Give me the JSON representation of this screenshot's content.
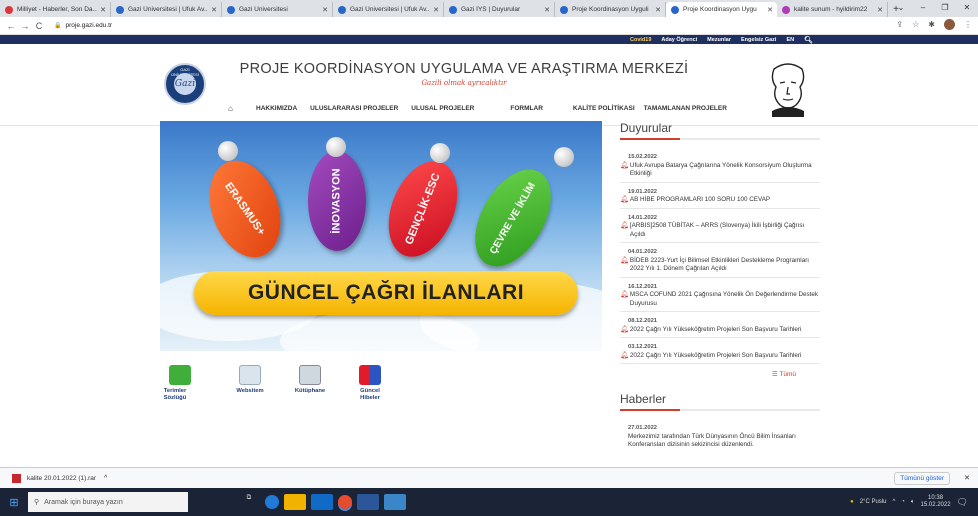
{
  "browser": {
    "tabs": [
      {
        "title": "Milliyet - Haberler, Son Da...",
        "color": "#d9373d"
      },
      {
        "title": "Gazi Üniversitesi | Ufuk Av...",
        "color": "#2a66c9"
      },
      {
        "title": "Gazi Üniversitesi",
        "color": "#2a66c9"
      },
      {
        "title": "Gazi Üniversitesi | Ufuk Av...",
        "color": "#2a66c9"
      },
      {
        "title": "Gazi İYS | Duyurular",
        "color": "#2a66c9"
      },
      {
        "title": "Proje Koordinasyon Uyguli",
        "color": "#2a66c9"
      },
      {
        "title": "Proje Koordinasyon Uygu",
        "color": "#2a66c9",
        "active": true
      },
      {
        "title": "kalite sunum - hyildirim22",
        "color": "#b03ab8"
      }
    ],
    "url": "proje.gazi.edu.tr"
  },
  "topnav": [
    "Covid19",
    "Aday Öğrenci",
    "Mezunlar",
    "Engelsiz Gazi",
    "EN"
  ],
  "header": {
    "title": "PROJE KOORDİNASYON UYGULAMA VE ARAŞTIRMA MERKEZİ",
    "subtitle": "Gazili olmak ayrıcalıktır",
    "logo_text": "Gazi"
  },
  "mainnav": [
    "HAKKIMIZDA",
    "ULUSLARARASI PROJELER",
    "ULUSAL PROJELER",
    "FORMLAR",
    "KALİTE POLİTİKASI",
    "TAMAMLANAN PROJELER"
  ],
  "banner": {
    "tags": [
      "ERASMUS+",
      "İNOVASYON",
      "GENÇLİK-ESC",
      "ÇEVRE VE İKLİM"
    ],
    "headline": "GÜNCEL ÇAĞRI İLANLARI"
  },
  "quicklinks": [
    {
      "label": "Terimler Sözlüğü"
    },
    {
      "label": "Websitem"
    },
    {
      "label": "Kütüphane"
    },
    {
      "label": "Güncel Hibeler"
    }
  ],
  "sidebar": {
    "announcements_title": "Duyurular",
    "announcements": [
      {
        "date": "15.02.2022",
        "text": "Ufuk Avrupa Batarya Çağrılarına Yönelik Konsorsiyum Oluşturma Etkinliği"
      },
      {
        "date": "19.01.2022",
        "text": "AB HİBE PROGRAMLARI 100 SORU 100 CEVAP"
      },
      {
        "date": "14.01.2022",
        "text": "[ARBIS]2508 TÜBİTAK – ARRS (Slovenya) İkili İşbirliği Çağrısı Açıldı"
      },
      {
        "date": "04.01.2022",
        "text": "BİDEB 2223-Yurt İçi Bilimsel Etkinlikleri Destekleme Programları 2022 Yılı 1. Dönem Çağrıları Açıldı"
      },
      {
        "date": "16.12.2021",
        "text": "MSCA COFUND 2021 Çağrısına Yönelik Ön Değerlendirme Destek Duyurusu"
      },
      {
        "date": "08.12.2021",
        "text": "2022 Çağrı Yılı Yükseköğretim Projeleri Son Başvuru Tarihleri"
      },
      {
        "date": "03.12.2021",
        "text": "2022 Çağrı Yılı Yükseköğretim Projeleri Son Başvuru Tarihleri"
      }
    ],
    "more_label": "Tümü",
    "news_title": "Haberler",
    "news": [
      {
        "date": "27.01.2022",
        "text": "Merkezimiz tarafından Türk Dünyasının Öncü Bilim İnsanları Konferansları dizisinin sekizincisi düzenlendi."
      }
    ]
  },
  "downloads": {
    "file": "kalite 20.01.2022 (1).rar",
    "show_all": "Tümünü göster"
  },
  "taskbar": {
    "search_placeholder": "Aramak için buraya yazın",
    "weather": "2°C Puslu",
    "time": "10:38",
    "date": "15.02.2022"
  }
}
